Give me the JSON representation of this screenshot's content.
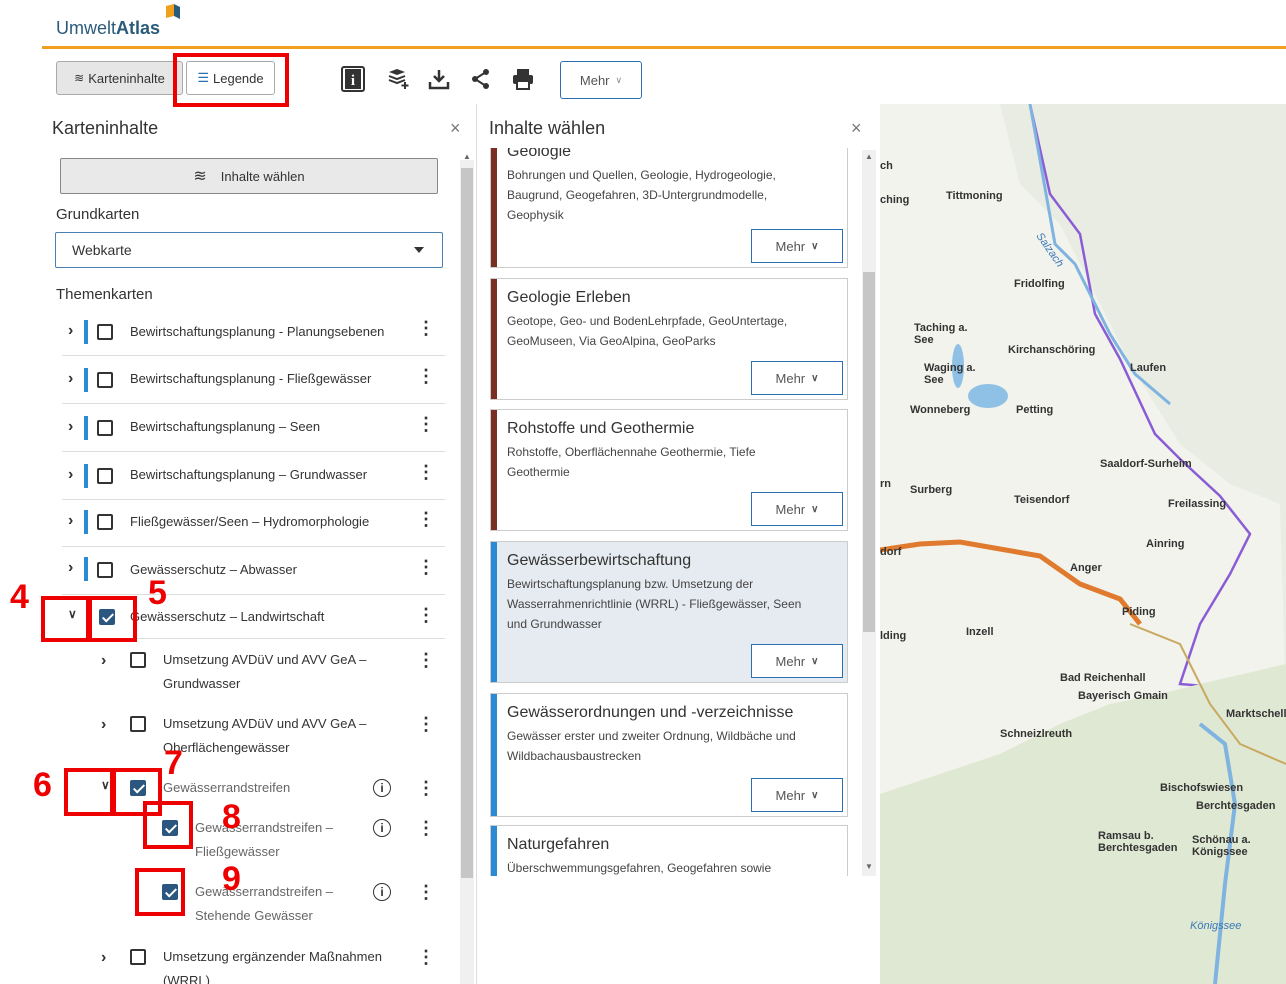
{
  "header": {
    "logo_prefix": "Umwelt",
    "logo_suffix": "Atlas"
  },
  "toolbar": {
    "karteninhalte_label": "Karteninhalte",
    "legende_label": "Legende",
    "mehr_label": "Mehr",
    "icons": [
      "info-icon",
      "layers-add-icon",
      "download-icon",
      "share-icon",
      "print-icon"
    ]
  },
  "left_panel": {
    "title": "Karteninhalte",
    "inhalte_button": "Inhalte wählen",
    "grundkarten_label": "Grundkarten",
    "grundkarten_value": "Webkarte",
    "themenkarten_label": "Themenkarten",
    "rows": [
      {
        "label": "Bewirtschaftungsplanung - Planungsebenen",
        "checked": false
      },
      {
        "label": "Bewirtschaftungsplanung - Fließgewässer",
        "checked": false
      },
      {
        "label": "Bewirtschaftungsplanung – Seen",
        "checked": false
      },
      {
        "label": "Bewirtschaftungsplanung – Grundwasser",
        "checked": false
      },
      {
        "label": "Fließgewässer/Seen – Hydromorphologie",
        "checked": false
      },
      {
        "label": "Gewässerschutz – Abwasser",
        "checked": false
      },
      {
        "label": "Gewässerschutz – Landwirtschaft",
        "checked": true
      }
    ],
    "sub_rows": [
      {
        "line1": "Umsetzung AVDüV und AVV GeA –",
        "line2": "Grundwasser"
      },
      {
        "line1": "Umsetzung AVDüV und AVV GeA –",
        "line2": "Oberflächengewässer"
      },
      {
        "line1": "Gewässerrandstreifen",
        "line2": ""
      },
      {
        "line1": "Gewässerrandstreifen –",
        "line2": "Fließgewässer"
      },
      {
        "line1": "Gewässerrandstreifen –",
        "line2": "Stehende Gewässer"
      },
      {
        "line1": "Umsetzung ergänzender Maßnahmen",
        "line2": "(WRRL)"
      }
    ]
  },
  "middle_panel": {
    "title": "Inhalte wählen",
    "cards": [
      {
        "title": "Geologie",
        "desc": "Bohrungen und Quellen, Geologie, Hydrogeologie, Baugrund, Geogefahren, 3D-Untergrundmodelle, Geophysik",
        "mehr": "Mehr"
      },
      {
        "title": "Geologie Erleben",
        "desc": "Geotope, Geo- und BodenLehrpfade, GeoUntertage, GeoMuseen, Via GeoAlpina, GeoParks",
        "mehr": "Mehr"
      },
      {
        "title": "Rohstoffe und Geothermie",
        "desc": "Rohstoffe, Oberflächennahe Geothermie, Tiefe Geothermie",
        "mehr": "Mehr"
      },
      {
        "title": "Gewässerbewirtschaftung",
        "desc": "Bewirtschaftungsplanung bzw. Umsetzung der Wasserrahmenrichtlinie (WRRL) - Fließgewässer, Seen und Grundwasser",
        "mehr": "Mehr"
      },
      {
        "title": "Gewässerordnungen und -verzeichnisse",
        "desc": "Gewässer erster und zweiter Ordnung, Wildbäche und Wildbachausbaustrecken",
        "mehr": "Mehr"
      },
      {
        "title": "Naturgefahren",
        "desc": "Überschwemmungsgefahren, Geogefahren sowie",
        "mehr": ""
      }
    ]
  },
  "map": {
    "labels": [
      "Tittmoning",
      "Fridolfing",
      "Taching a. See",
      "Kirchanschöring",
      "Waging a. See",
      "Laufen",
      "Wonneberg",
      "Petting",
      "Saaldorf-Surheim",
      "Surberg",
      "Teisendorf",
      "Freilassing",
      "Ainring",
      "Anger",
      "Piding",
      "Inzell",
      "Bad Reichenhall",
      "Bayerisch Gmain",
      "Marktschellenberg",
      "Schneizlreuth",
      "Bischofswiesen",
      "Berchtesgaden",
      "Ramsau b. Berchtesgaden",
      "Schönau a. Königssee",
      "Königssee",
      "Salzach",
      "ching",
      "ch",
      "rn",
      "dorf",
      "lding"
    ]
  },
  "annotations": [
    "4",
    "5",
    "6",
    "7",
    "8",
    "9"
  ]
}
